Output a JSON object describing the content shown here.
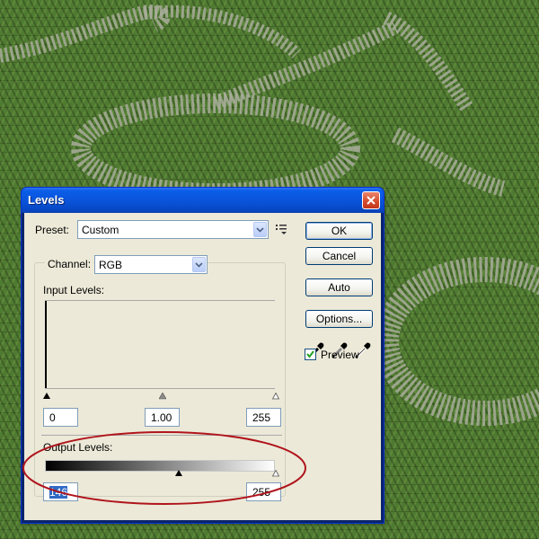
{
  "window": {
    "title": "Levels"
  },
  "preset": {
    "label": "Preset:",
    "value": "Custom"
  },
  "channel": {
    "label": "Channel:",
    "value": "RGB"
  },
  "input_levels": {
    "label": "Input Levels:",
    "black": "0",
    "gamma": "1.00",
    "white": "255"
  },
  "output_levels": {
    "label": "Output Levels:",
    "black": "146",
    "white": "255"
  },
  "buttons": {
    "ok": "OK",
    "cancel": "Cancel",
    "auto": "Auto",
    "options": "Options..."
  },
  "preview": {
    "label": "Preview",
    "checked": true
  },
  "icons": {
    "close": "close-icon",
    "preset_menu": "preset-menu-icon",
    "eyedroppers": [
      "black-eyedropper-icon",
      "gray-eyedropper-icon",
      "white-eyedropper-icon"
    ]
  },
  "colors": {
    "background": "#4f7a31",
    "title_bar": "#0a53d8",
    "annotation": "#b0141c"
  }
}
